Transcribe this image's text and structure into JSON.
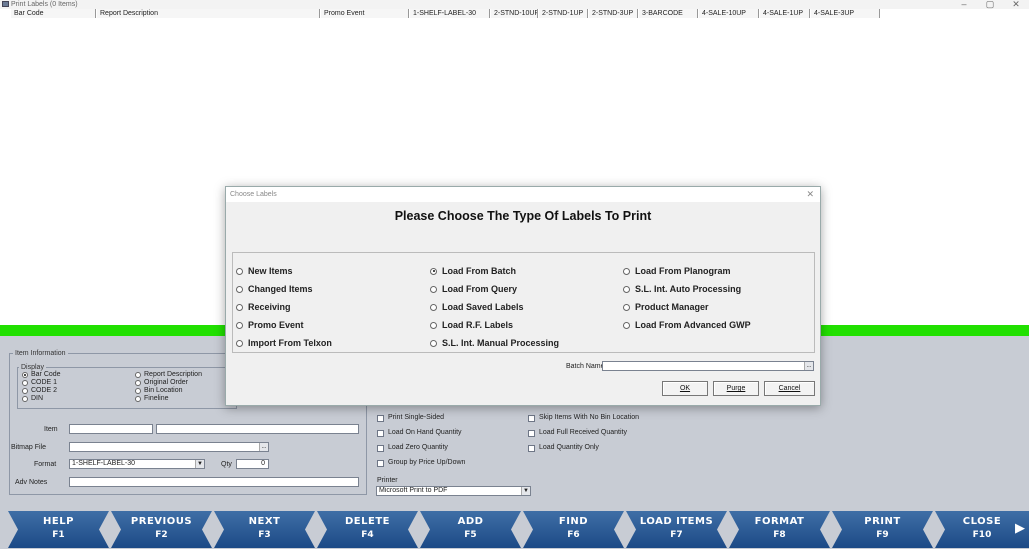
{
  "window": {
    "title": "Print Labels (0 Items)",
    "controls": [
      "–",
      "▢",
      "✕"
    ]
  },
  "grid": {
    "columns": [
      "Bar Code",
      "Report Description",
      "Promo Event",
      "1-SHELF-LABEL-30",
      "2-STND-10UP",
      "2-STND-1UP",
      "2-STND-3UP",
      "3-BARCODE",
      "4-SALE-10UP",
      "4-SALE-1UP",
      "4-SALE-3UP"
    ]
  },
  "item_info": {
    "legend": "Item Information",
    "display_legend": "Display",
    "display_options": [
      {
        "label": "Bar Code",
        "checked": true
      },
      {
        "label": "CODE 1",
        "checked": false
      },
      {
        "label": "CODE 2",
        "checked": false
      },
      {
        "label": "DIN",
        "checked": false
      },
      {
        "label": "Report Description",
        "checked": false
      },
      {
        "label": "Original Order",
        "checked": false
      },
      {
        "label": "Bin Location",
        "checked": false
      },
      {
        "label": "Fineline",
        "checked": false
      }
    ],
    "item_label": "Item",
    "bitmap_label": "Bitmap File",
    "bitmap_btn": "...",
    "format_label": "Format",
    "format_value": "1-SHELF-LABEL-30",
    "qty_label": "Qty",
    "qty_value": "0",
    "adv_notes_label": "Adv Notes"
  },
  "options": {
    "checks": [
      {
        "label": "Print Single-Sided"
      },
      {
        "label": "Load On Hand Quantity"
      },
      {
        "label": "Load Zero Quantity"
      },
      {
        "label": "Group by Price Up/Down"
      },
      {
        "label": "Skip Items With No Bin Location"
      },
      {
        "label": "Load Full Received Quantity"
      },
      {
        "label": "Load Quantity Only"
      }
    ],
    "printer_label": "Printer",
    "printer_value": "Microsoft Print to PDF"
  },
  "fkeys": [
    {
      "name": "HELP",
      "key": "F1"
    },
    {
      "name": "PREVIOUS",
      "key": "F2"
    },
    {
      "name": "NEXT",
      "key": "F3"
    },
    {
      "name": "DELETE",
      "key": "F4"
    },
    {
      "name": "ADD",
      "key": "F5"
    },
    {
      "name": "FIND",
      "key": "F6"
    },
    {
      "name": "LOAD ITEMS",
      "key": "F7"
    },
    {
      "name": "FORMAT",
      "key": "F8"
    },
    {
      "name": "PRINT",
      "key": "F9"
    },
    {
      "name": "CLOSE",
      "key": "F10"
    }
  ],
  "dialog": {
    "title": "Choose Labels",
    "close": "✕",
    "heading": "Please Choose The Type Of Labels To Print",
    "options_col1": [
      {
        "label": "New Items",
        "checked": false
      },
      {
        "label": "Changed Items",
        "checked": false
      },
      {
        "label": "Receiving",
        "checked": false
      },
      {
        "label": "Promo Event",
        "checked": false
      },
      {
        "label": "Import From Telxon",
        "checked": false
      }
    ],
    "options_col2": [
      {
        "label": "Load From Batch",
        "checked": true
      },
      {
        "label": "Load From Query",
        "checked": false
      },
      {
        "label": "Load Saved Labels",
        "checked": false
      },
      {
        "label": "Load R.F. Labels",
        "checked": false
      },
      {
        "label": "S.L. Int. Manual Processing",
        "checked": false
      }
    ],
    "options_col3": [
      {
        "label": "Load From Planogram",
        "checked": false
      },
      {
        "label": "S.L. Int. Auto Processing",
        "checked": false
      },
      {
        "label": "Product Manager",
        "checked": false
      },
      {
        "label": "Load From Advanced GWP",
        "checked": false
      }
    ],
    "batch_label": "Batch Name",
    "batch_value": "",
    "batch_btn": "...",
    "ok": "OK",
    "purge": "Purge",
    "cancel": "Cancel"
  }
}
